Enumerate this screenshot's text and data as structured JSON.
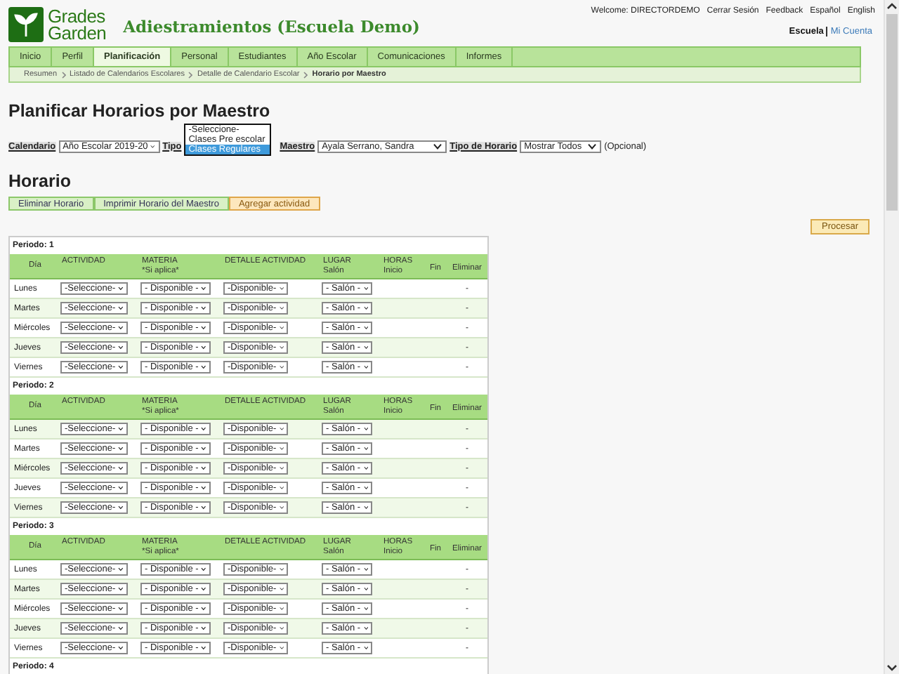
{
  "header": {
    "logo": {
      "line1": "Grades",
      "line2": "Garden"
    },
    "school": "Adiestramientos (Escuela Demo)",
    "welcome": "Welcome: DIRECTORDEMO",
    "links": [
      "Cerrar Sesión",
      "Feedback",
      "Español",
      "English"
    ],
    "account_links": [
      {
        "label": "Escuela",
        "selected": true
      },
      {
        "label": "Mi Cuenta",
        "selected": false
      }
    ]
  },
  "nav": {
    "tabs": [
      {
        "label": "Inicio",
        "selected": false
      },
      {
        "label": "Perfil",
        "selected": false
      },
      {
        "label": "Planificación",
        "selected": true
      },
      {
        "label": "Personal",
        "selected": false
      },
      {
        "label": "Estudiantes",
        "selected": false
      },
      {
        "label": "Año Escolar",
        "selected": false
      },
      {
        "label": "Comunicaciones",
        "selected": false
      },
      {
        "label": "Informes",
        "selected": false
      }
    ],
    "breadcrumb": [
      "Resumen",
      "Listado de Calendarios Escolares",
      "Detalle de Calendario Escolar",
      "Horario por Maestro"
    ]
  },
  "page_title": "Planificar Horarios por Maestro",
  "filters": [
    {
      "kind": "select",
      "label": "Calendario",
      "value": "Año Escolar 2019-20"
    },
    {
      "kind": "open_list",
      "label": "Tipo",
      "options": [
        {
          "label": "-Seleccione-",
          "selected": false
        },
        {
          "label": "Clases Pre escolar",
          "selected": false
        },
        {
          "label": "Clases Regulares",
          "selected": true
        }
      ]
    },
    {
      "kind": "select",
      "label": "Maestro",
      "value": "Ayala Serrano, Sandra"
    },
    {
      "kind": "select",
      "label": "Tipo de Horario",
      "value": "Mostrar Todos",
      "note": "(Opcional)"
    }
  ],
  "section_title": "Horario",
  "actions": [
    {
      "label": "Eliminar Horario",
      "kind": "green"
    },
    {
      "label": "Imprimir Horario del Maestro",
      "kind": "green"
    },
    {
      "label": "Agregar actividad",
      "kind": "orange"
    }
  ],
  "process_button": "Procesar",
  "schedule": {
    "periods": [
      {
        "label": "Periodo: 1",
        "columns": [
          {
            "label": "Día"
          },
          {
            "label": "ACTIVIDAD"
          },
          {
            "label": "MATERIA",
            "sub": "*Si aplica*"
          },
          {
            "label": "DETALLE ACTIVIDAD"
          },
          {
            "label": "LUGAR",
            "sub": "Salón"
          },
          {
            "label": "HORAS",
            "sub": "Inicio"
          },
          {
            "sub": "Fin"
          },
          {
            "sub": "Eliminar"
          }
        ],
        "rows": [
          {
            "day": "Lunes",
            "actividad": "-Seleccione-",
            "materia": "- Disponible -",
            "detalle": "-Disponible-",
            "lugar": "- Salón -",
            "eliminar": "-"
          },
          {
            "day": "Martes",
            "actividad": "-Seleccione-",
            "materia": "- Disponible -",
            "detalle": "-Disponible-",
            "lugar": "- Salón -",
            "eliminar": "-"
          },
          {
            "day": "Miércoles",
            "actividad": "-Seleccione-",
            "materia": "- Disponible -",
            "detalle": "-Disponible-",
            "lugar": "- Salón -",
            "eliminar": "-"
          },
          {
            "day": "Jueves",
            "actividad": "-Seleccione-",
            "materia": "- Disponible -",
            "detalle": "-Disponible-",
            "lugar": "- Salón -",
            "eliminar": "-"
          },
          {
            "day": "Viernes",
            "actividad": "-Seleccione-",
            "materia": "- Disponible -",
            "detalle": "-Disponible-",
            "lugar": "- Salón -",
            "eliminar": "-"
          }
        ]
      },
      {
        "label": "Periodo: 2",
        "columns": [
          {
            "label": "Día"
          },
          {
            "label": "ACTIVIDAD"
          },
          {
            "label": "MATERIA",
            "sub": "*Si aplica*"
          },
          {
            "label": "DETALLE ACTIVIDAD"
          },
          {
            "label": "LUGAR",
            "sub": "Salón"
          },
          {
            "label": "HORAS",
            "sub": "Inicio"
          },
          {
            "sub": "Fin"
          },
          {
            "sub": "Eliminar"
          }
        ],
        "rows": [
          {
            "day": "Lunes",
            "actividad": "-Seleccione-",
            "materia": "- Disponible -",
            "detalle": "-Disponible-",
            "lugar": "- Salón -",
            "eliminar": "-"
          },
          {
            "day": "Martes",
            "actividad": "-Seleccione-",
            "materia": "- Disponible -",
            "detalle": "-Disponible-",
            "lugar": "- Salón -",
            "eliminar": "-"
          },
          {
            "day": "Miércoles",
            "actividad": "-Seleccione-",
            "materia": "- Disponible -",
            "detalle": "-Disponible-",
            "lugar": "- Salón -",
            "eliminar": "-"
          },
          {
            "day": "Jueves",
            "actividad": "-Seleccione-",
            "materia": "- Disponible -",
            "detalle": "-Disponible-",
            "lugar": "- Salón -",
            "eliminar": "-"
          },
          {
            "day": "Viernes",
            "actividad": "-Seleccione-",
            "materia": "- Disponible -",
            "detalle": "-Disponible-",
            "lugar": "- Salón -",
            "eliminar": "-"
          }
        ]
      },
      {
        "label": "Periodo: 3",
        "columns": [
          {
            "label": "Día"
          },
          {
            "label": "ACTIVIDAD"
          },
          {
            "label": "MATERIA",
            "sub": "*Si aplica*"
          },
          {
            "label": "DETALLE ACTIVIDAD"
          },
          {
            "label": "LUGAR",
            "sub": "Salón"
          },
          {
            "label": "HORAS",
            "sub": "Inicio"
          },
          {
            "sub": "Fin"
          },
          {
            "sub": "Eliminar"
          }
        ],
        "rows": [
          {
            "day": "Lunes",
            "actividad": "-Seleccione-",
            "materia": "- Disponible -",
            "detalle": "-Disponible-",
            "lugar": "- Salón -",
            "eliminar": "-"
          },
          {
            "day": "Martes",
            "actividad": "-Seleccione-",
            "materia": "- Disponible -",
            "detalle": "-Disponible-",
            "lugar": "- Salón -",
            "eliminar": "-"
          },
          {
            "day": "Miércoles",
            "actividad": "-Seleccione-",
            "materia": "- Disponible -",
            "detalle": "-Disponible-",
            "lugar": "- Salón -",
            "eliminar": "-"
          },
          {
            "day": "Jueves",
            "actividad": "-Seleccione-",
            "materia": "- Disponible -",
            "detalle": "-Disponible-",
            "lugar": "- Salón -",
            "eliminar": "-"
          },
          {
            "day": "Viernes",
            "actividad": "-Seleccione-",
            "materia": "- Disponible -",
            "detalle": "-Disponible-",
            "lugar": "- Salón -",
            "eliminar": "-"
          }
        ]
      },
      {
        "label": "Periodo: 4"
      }
    ]
  }
}
